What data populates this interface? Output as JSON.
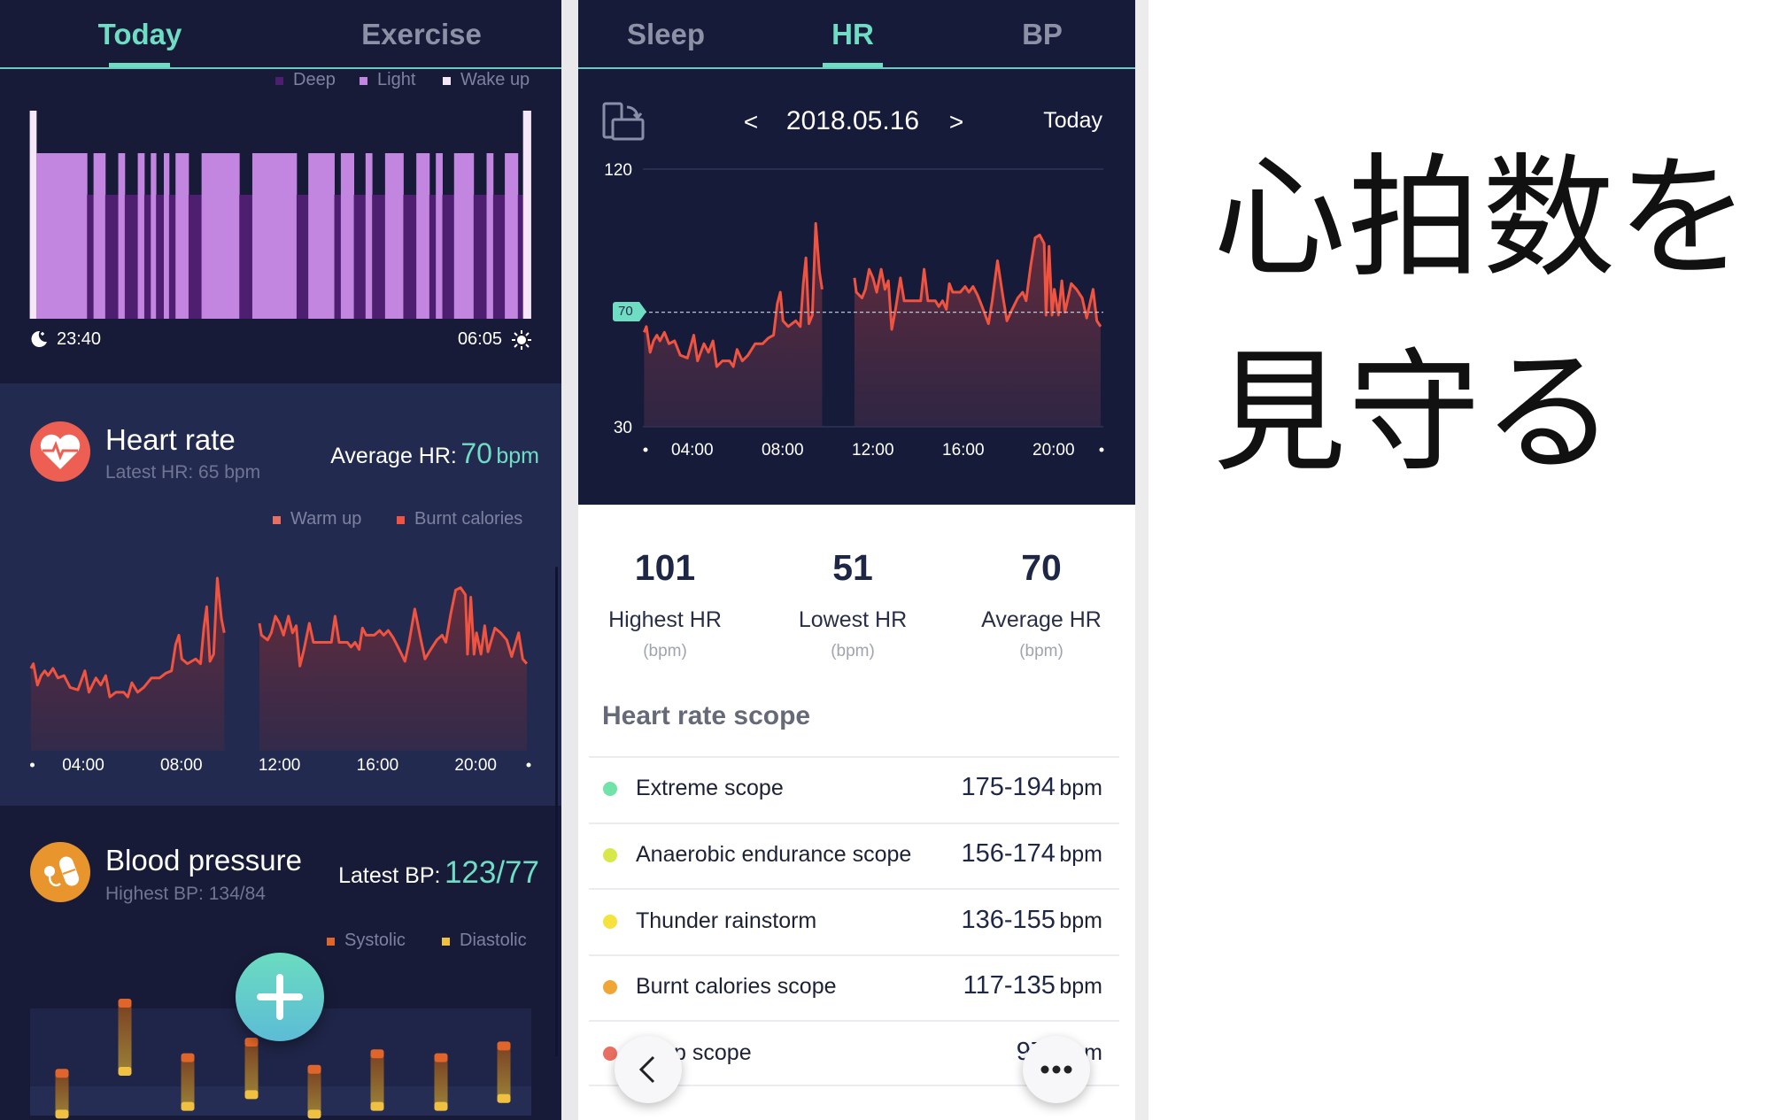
{
  "colors": {
    "accent": "#6fdcc4",
    "hr_line": "#f0533f",
    "deep": "#4e1f70",
    "light": "#c285e0",
    "wake": "#f5e6f8",
    "systolic": "#e0652a",
    "diastolic": "#f0c040",
    "extreme": "#6fe3a8",
    "anaerobic": "#d6e84a",
    "thunder": "#f5e23c",
    "burnt": "#f0a634",
    "warmup": "#ea6f62"
  },
  "left": {
    "tabs": [
      {
        "label": "Today",
        "active": true
      },
      {
        "label": "Exercise",
        "active": false
      }
    ],
    "sleep": {
      "legend": [
        "Deep",
        "Light",
        "Wake up"
      ],
      "start": "23:40",
      "end": "06:05",
      "start_icon": "moon-icon",
      "end_icon": "sun-icon"
    },
    "heart_rate": {
      "title": "Heart rate",
      "latest": "Latest HR: 65 bpm",
      "avg_label": "Average HR:",
      "avg_value": "70",
      "avg_unit": "bpm",
      "legend": [
        "Warm up",
        "Burnt calories"
      ],
      "icon": "heart-pulse-icon"
    },
    "blood_pressure": {
      "title": "Blood pressure",
      "highest": "Highest BP: 134/84",
      "latest_label": "Latest BP:",
      "latest_value": "123/77",
      "legend": [
        "Systolic",
        "Diastolic"
      ],
      "icon": "blood-pressure-icon"
    },
    "fab_icon": "plus-icon"
  },
  "middle": {
    "tabs": [
      {
        "label": "Sleep",
        "active": false
      },
      {
        "label": "HR",
        "active": true
      },
      {
        "label": "BP",
        "active": false
      }
    ],
    "date": "2018.05.16",
    "prev": "<",
    "next": ">",
    "today_label": "Today",
    "rotate_icon": "rotate-screen-icon",
    "avg_badge": "70",
    "stats": [
      {
        "value": "101",
        "label": "Highest HR",
        "unit": "(bpm)"
      },
      {
        "value": "51",
        "label": "Lowest HR",
        "unit": "(bpm)"
      },
      {
        "value": "70",
        "label": "Average HR",
        "unit": "(bpm)"
      }
    ],
    "scope_title": "Heart rate scope",
    "scopes": [
      {
        "label": "Extreme scope",
        "range": "175-194",
        "unit": "bpm",
        "color": "#6fe3a8"
      },
      {
        "label": "Anaerobic endurance scope",
        "range": "156-174",
        "unit": "bpm",
        "color": "#d6e84a"
      },
      {
        "label": "Thunder rainstorm",
        "range": "136-155",
        "unit": "bpm",
        "color": "#f5e23c"
      },
      {
        "label": "Burnt calories scope",
        "range": "117-135",
        "unit": "bpm",
        "color": "#f0a634"
      },
      {
        "label": "m-up scope",
        "range": "97-11",
        "unit": "m",
        "color": "#ea6f62"
      }
    ],
    "back_icon": "chevron-left-icon",
    "more_icon": "more-dots-icon"
  },
  "caption": {
    "line1": "心拍数を",
    "line2": "見守る"
  },
  "chart_data": {
    "sleep": {
      "type": "bar",
      "x_range": [
        "23:40",
        "06:05"
      ],
      "stages": [
        [
          "wake",
          "23:40",
          "23:45"
        ],
        [
          "light",
          "23:45",
          "00:24"
        ],
        [
          "deep",
          "00:24",
          "00:29"
        ],
        [
          "light",
          "00:29",
          "00:38"
        ],
        [
          "deep",
          "00:38",
          "00:48"
        ],
        [
          "light",
          "00:48",
          "00:53"
        ],
        [
          "deep",
          "00:53",
          "01:03"
        ],
        [
          "light",
          "01:03",
          "01:08"
        ],
        [
          "deep",
          "01:08",
          "01:13"
        ],
        [
          "light",
          "01:13",
          "01:17"
        ],
        [
          "deep",
          "01:17",
          "01:23"
        ],
        [
          "light",
          "01:23",
          "01:27"
        ],
        [
          "deep",
          "01:27",
          "01:32"
        ],
        [
          "light",
          "01:32",
          "01:42"
        ],
        [
          "deep",
          "01:42",
          "01:52"
        ],
        [
          "light",
          "01:52",
          "02:21"
        ],
        [
          "deep",
          "02:21",
          "02:31"
        ],
        [
          "light",
          "02:31",
          "03:05"
        ],
        [
          "deep",
          "03:05",
          "03:14"
        ],
        [
          "light",
          "03:14",
          "03:34"
        ],
        [
          "deep",
          "03:34",
          "03:39"
        ],
        [
          "light",
          "03:39",
          "03:49"
        ],
        [
          "deep",
          "03:49",
          "03:58"
        ],
        [
          "light",
          "03:58",
          "04:03"
        ],
        [
          "deep",
          "04:03",
          "04:13"
        ],
        [
          "light",
          "04:13",
          "04:27"
        ],
        [
          "deep",
          "04:27",
          "04:37"
        ],
        [
          "light",
          "04:37",
          "04:47"
        ],
        [
          "deep",
          "04:47",
          "04:52"
        ],
        [
          "light",
          "04:52",
          "04:57"
        ],
        [
          "deep",
          "04:57",
          "05:06"
        ],
        [
          "light",
          "05:06",
          "05:21"
        ],
        [
          "deep",
          "05:21",
          "05:31"
        ],
        [
          "light",
          "05:31",
          "05:36"
        ],
        [
          "deep",
          "05:36",
          "05:45"
        ],
        [
          "light",
          "05:45",
          "05:55"
        ],
        [
          "deep",
          "05:55",
          "05:59"
        ],
        [
          "wake",
          "05:59",
          "06:05"
        ]
      ]
    },
    "heart_rate": {
      "type": "area",
      "x_ticks": [
        "04:00",
        "08:00",
        "12:00",
        "16:00",
        "20:00"
      ],
      "y_ticks": [
        120,
        30
      ],
      "ylim": [
        30,
        120
      ],
      "reference": 70,
      "segments": [
        [
          [
            "01:52",
            63
          ],
          [
            "01:58",
            65
          ],
          [
            "02:08",
            56
          ],
          [
            "02:17",
            60
          ],
          [
            "02:26",
            62
          ],
          [
            "02:34",
            60
          ],
          [
            "02:46",
            63
          ],
          [
            "02:58",
            59
          ],
          [
            "03:13",
            60
          ],
          [
            "03:28",
            55
          ],
          [
            "03:47",
            54
          ],
          [
            "04:04",
            62
          ],
          [
            "04:14",
            53
          ],
          [
            "04:31",
            59
          ],
          [
            "04:43",
            56
          ],
          [
            "04:55",
            60
          ],
          [
            "05:05",
            51
          ],
          [
            "05:20",
            53
          ],
          [
            "05:39",
            53
          ],
          [
            "05:49",
            51
          ],
          [
            "05:59",
            57
          ],
          [
            "06:13",
            53
          ],
          [
            "06:28",
            55
          ],
          [
            "06:47",
            59
          ],
          [
            "07:07",
            59
          ],
          [
            "07:22",
            61
          ],
          [
            "07:36",
            62
          ],
          [
            "07:46",
            73
          ],
          [
            "07:54",
            77
          ],
          [
            "08:01",
            67
          ],
          [
            "08:15",
            65
          ],
          [
            "08:35",
            67
          ],
          [
            "08:47",
            65
          ],
          [
            "08:55",
            80
          ],
          [
            "09:02",
            89
          ],
          [
            "09:10",
            66
          ],
          [
            "09:19",
            69
          ],
          [
            "09:28",
            101
          ],
          [
            "09:38",
            84
          ],
          [
            "09:45",
            78
          ]
        ],
        [
          [
            "11:11",
            82
          ],
          [
            "11:16",
            77
          ],
          [
            "11:31",
            75
          ],
          [
            "11:40",
            78
          ],
          [
            "11:50",
            85
          ],
          [
            "12:00",
            82
          ],
          [
            "12:10",
            77
          ],
          [
            "12:22",
            85
          ],
          [
            "12:32",
            78
          ],
          [
            "12:41",
            81
          ],
          [
            "12:50",
            64
          ],
          [
            "13:00",
            71
          ],
          [
            "13:13",
            82
          ],
          [
            "13:23",
            74
          ],
          [
            "13:47",
            74
          ],
          [
            "14:07",
            74
          ],
          [
            "14:16",
            85
          ],
          [
            "14:26",
            74
          ],
          [
            "14:46",
            74
          ],
          [
            "14:55",
            72
          ],
          [
            "15:05",
            74
          ],
          [
            "15:15",
            71
          ],
          [
            "15:23",
            80
          ],
          [
            "15:32",
            77
          ],
          [
            "15:52",
            77
          ],
          [
            "16:05",
            79
          ],
          [
            "16:15",
            77
          ],
          [
            "16:26",
            79
          ],
          [
            "16:38",
            76
          ],
          [
            "16:50",
            72
          ],
          [
            "17:07",
            66
          ],
          [
            "17:17",
            74
          ],
          [
            "17:31",
            88
          ],
          [
            "17:46",
            75
          ],
          [
            "17:56",
            67
          ],
          [
            "18:10",
            71
          ],
          [
            "18:25",
            75
          ],
          [
            "18:38",
            77
          ],
          [
            "18:47",
            74
          ],
          [
            "18:59",
            86
          ],
          [
            "19:11",
            96
          ],
          [
            "19:23",
            97
          ],
          [
            "19:35",
            94
          ],
          [
            "19:40",
            69
          ],
          [
            "19:48",
            93
          ],
          [
            "19:56",
            69
          ],
          [
            "20:02",
            78
          ],
          [
            "20:13",
            69
          ],
          [
            "20:22",
            81
          ],
          [
            "20:30",
            70
          ],
          [
            "20:47",
            80
          ],
          [
            "21:01",
            78
          ],
          [
            "21:16",
            75
          ],
          [
            "21:28",
            68
          ],
          [
            "21:45",
            78
          ],
          [
            "21:55",
            67
          ],
          [
            "22:05",
            65
          ]
        ]
      ]
    },
    "blood_pressure": {
      "type": "bar",
      "series": [
        {
          "name": "Systolic",
          "values": [
            116,
            134,
            120,
            124,
            117,
            121,
            120,
            123
          ]
        },
        {
          "name": "Diastolic",
          "values": [
            73,
            84,
            75,
            78,
            73,
            75,
            75,
            77
          ]
        }
      ]
    }
  }
}
